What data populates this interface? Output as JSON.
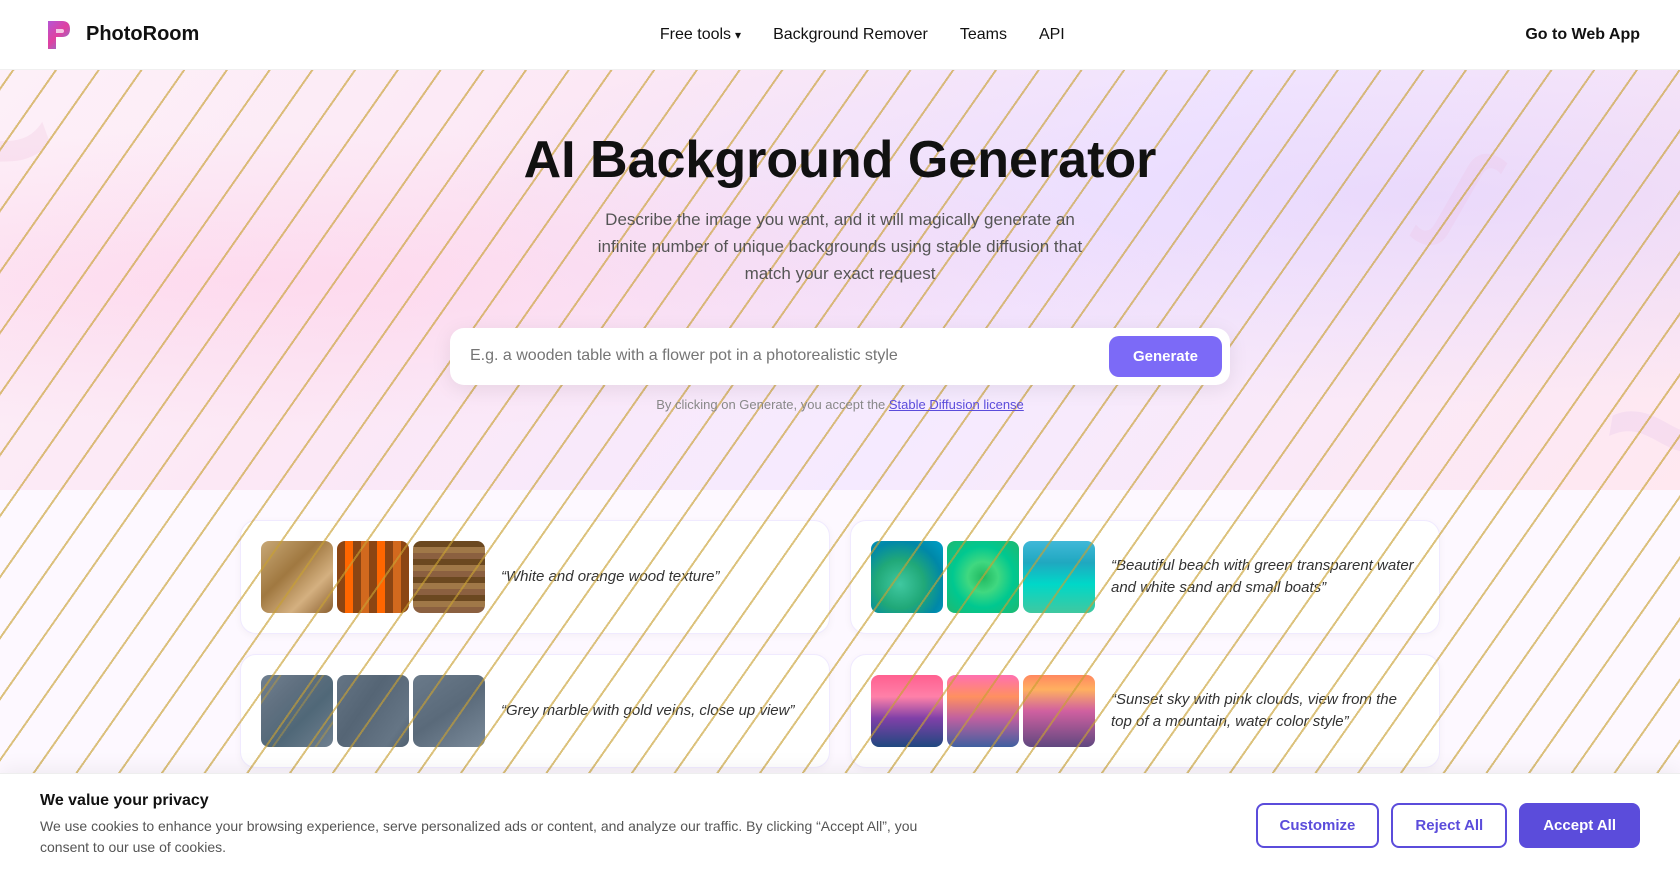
{
  "header": {
    "logo_text": "PhotoRoom",
    "nav": {
      "free_tools": "Free tools",
      "background_remover": "Background Remover",
      "teams": "Teams",
      "api": "API",
      "go_to_web_app": "Go to Web App"
    }
  },
  "hero": {
    "title": "AI Background Generator",
    "subtitle": "Describe the image you want, and it will magically generate an infinite number of unique backgrounds using stable diffusion that match your exact request",
    "search_placeholder": "E.g. a wooden table with a flower pot in a photorealistic style",
    "generate_btn": "Generate",
    "license_prefix": "By clicking on Generate, you accept the ",
    "license_link": "Stable Diffusion license"
  },
  "examples": [
    {
      "id": "wood",
      "quote": "“White and orange wood texture”",
      "images": [
        "img-wood-1",
        "img-wood-2",
        "img-wood-3"
      ]
    },
    {
      "id": "beach",
      "quote": "“Beautiful beach with green transparent water and white sand and small boats”",
      "images": [
        "img-beach-1",
        "img-beach-2",
        "img-beach-3"
      ]
    },
    {
      "id": "marble",
      "quote": "“Grey marble with gold veins, close up view”",
      "images": [
        "img-marble-1",
        "img-marble-2",
        "img-marble-3"
      ]
    },
    {
      "id": "sunset",
      "quote": "“Sunset sky with pink clouds, view from the top of a mountain, water color style”",
      "images": [
        "img-sunset-1",
        "img-sunset-2",
        "img-sunset-3"
      ]
    }
  ],
  "cookie_banner": {
    "title": "We value your privacy",
    "description": "We use cookies to enhance your browsing experience, serve personalized ads or content, and analyze our traffic. By clicking “Accept All”, you consent to our use of cookies.",
    "customize_label": "Customize",
    "reject_label": "Reject All",
    "accept_label": "Accept All"
  }
}
